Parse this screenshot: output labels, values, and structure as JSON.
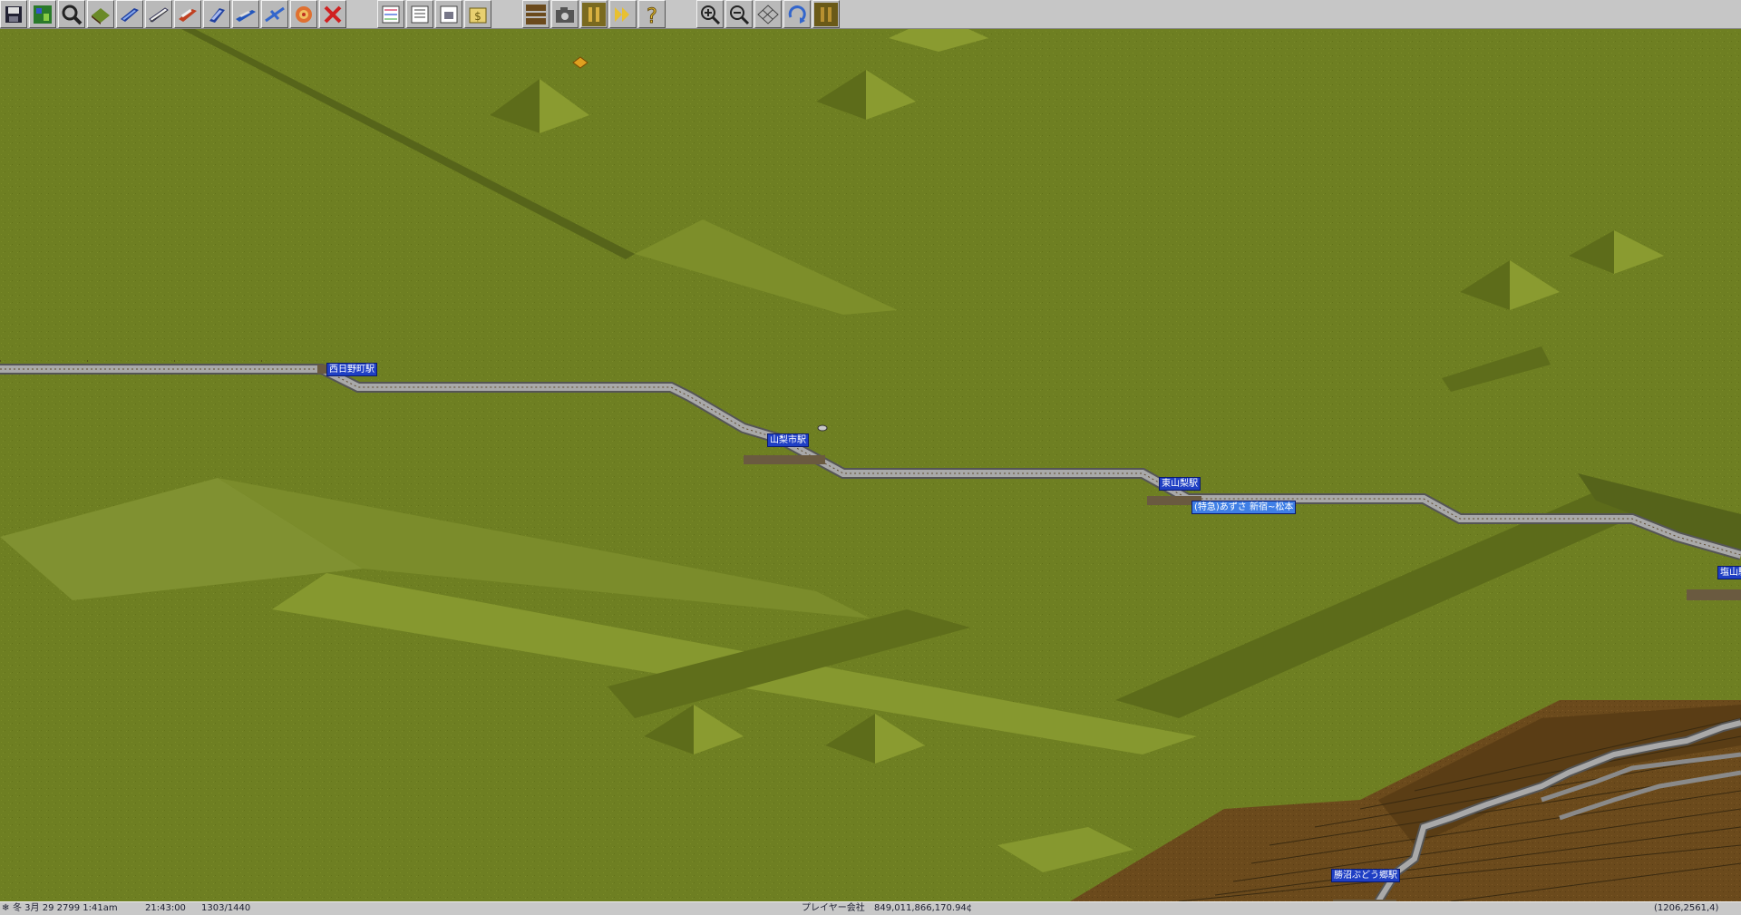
{
  "toolbar": {
    "buttons": [
      {
        "name": "save-icon",
        "tip": "Save"
      },
      {
        "name": "minimap-icon",
        "tip": "Map"
      },
      {
        "name": "magnifier-icon",
        "tip": "Inspect"
      },
      {
        "name": "terrain-icon",
        "tip": "Landscape"
      },
      {
        "name": "train-icon",
        "tip": "Rail"
      },
      {
        "name": "monorail-icon",
        "tip": "Monorail"
      },
      {
        "name": "tram-icon",
        "tip": "Tram"
      },
      {
        "name": "bus-icon",
        "tip": "Road"
      },
      {
        "name": "ship-icon",
        "tip": "Ship"
      },
      {
        "name": "airplane-icon",
        "tip": "Air"
      },
      {
        "name": "target-icon",
        "tip": "Special"
      },
      {
        "name": "remove-icon",
        "tip": "Remove"
      },
      {
        "name": "line-management-icon",
        "tip": "Lines"
      },
      {
        "name": "list-icon",
        "tip": "Lists"
      },
      {
        "name": "depot-list-icon",
        "tip": "Depots"
      },
      {
        "name": "finance-icon",
        "tip": "Finances"
      },
      {
        "name": "minimap-rail-icon",
        "tip": "Overview"
      },
      {
        "name": "camera-icon",
        "tip": "Screenshot"
      },
      {
        "name": "pause-icon",
        "tip": "Pause"
      },
      {
        "name": "fast-forward-icon",
        "tip": "Fast forward"
      },
      {
        "name": "help-icon",
        "tip": "Help"
      },
      {
        "name": "zoom-in-icon",
        "tip": "Zoom in"
      },
      {
        "name": "zoom-out-icon",
        "tip": "Zoom out"
      },
      {
        "name": "grid-icon",
        "tip": "Grid"
      },
      {
        "name": "rotate-icon",
        "tip": "Rotate"
      },
      {
        "name": "pause-box-icon",
        "tip": "Pause box"
      }
    ]
  },
  "map": {
    "stations": [
      {
        "label": "西日野町駅"
      },
      {
        "label": "山梨市駅"
      },
      {
        "label": "東山梨駅"
      },
      {
        "label": "塩山駅"
      },
      {
        "label": "勝沼ぶどう郷駅"
      }
    ],
    "convoy": {
      "label": "(特急)あずさ 新宿~松本"
    }
  },
  "statusbar": {
    "date": "冬 3月 29 2799  1:41am",
    "clock": "21:43:00",
    "ratio": "1303/1440",
    "company": "プレイヤー会社",
    "money": "849,011,866,170.94¢",
    "coords": "(1206,2561,4)"
  },
  "colors": {
    "grass": "#6e7f22",
    "grass_light": "#8a9a2e",
    "grass_dark": "#59671a",
    "dirt": "#6b4a1c",
    "toolbar": "#c6c6c6",
    "station_label": "#1f3fc4",
    "convoy_label": "#3f7fe6",
    "rail": "#8a8a8a"
  }
}
